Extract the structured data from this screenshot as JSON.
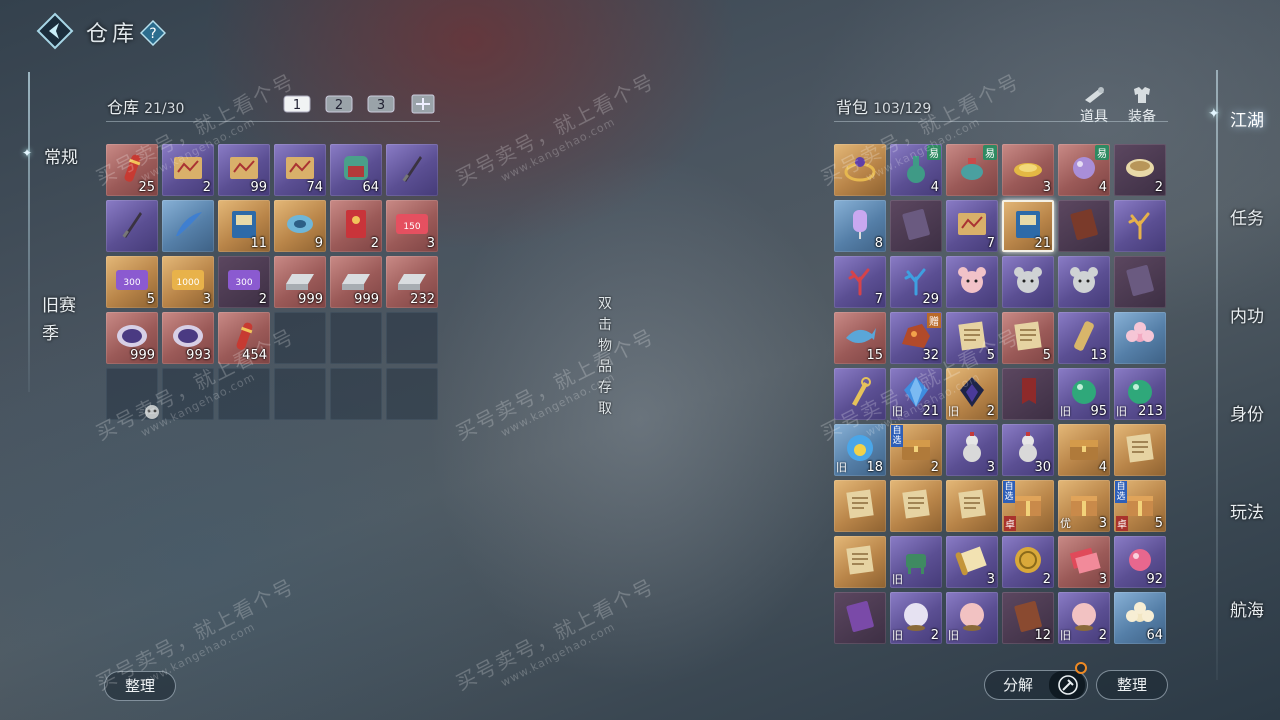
{
  "header": {
    "title": "仓库",
    "help": "?"
  },
  "left_tabs": [
    {
      "label": "常规",
      "active": true
    },
    {
      "label": "旧赛季",
      "active": false
    }
  ],
  "warehouse": {
    "label": "仓库",
    "count": "21/30",
    "pages": [
      "1",
      "2",
      "3"
    ],
    "sort_label": "整理",
    "slots": [
      {
        "q": "red",
        "icon": "red-scroll",
        "qty": "25"
      },
      {
        "q": "purple",
        "icon": "treasure-map",
        "qty": "2"
      },
      {
        "q": "purple",
        "icon": "treasure-map",
        "qty": "99"
      },
      {
        "q": "purple",
        "icon": "treasure-map",
        "qty": "74"
      },
      {
        "q": "purple",
        "icon": "jade-seal",
        "qty": "64"
      },
      {
        "q": "purple",
        "icon": "dagger",
        "qty": ""
      },
      {
        "q": "purple",
        "icon": "dagger",
        "qty": ""
      },
      {
        "q": "blue",
        "icon": "blue-feather",
        "qty": ""
      },
      {
        "q": "gold",
        "icon": "blue-book",
        "qty": "11"
      },
      {
        "q": "gold",
        "icon": "blue-disc",
        "qty": "9"
      },
      {
        "q": "red",
        "icon": "red-envelope",
        "qty": "2"
      },
      {
        "q": "red",
        "icon": "voucher-150",
        "qty": "3",
        "label": "150"
      },
      {
        "q": "gold",
        "icon": "voucher-300",
        "qty": "5",
        "label": "300"
      },
      {
        "q": "gold",
        "icon": "voucher-1000",
        "qty": "3",
        "label": "1000"
      },
      {
        "q": "dark",
        "icon": "voucher-300",
        "qty": "2",
        "label": "300"
      },
      {
        "q": "red",
        "icon": "silver-ingot",
        "qty": "999"
      },
      {
        "q": "red",
        "icon": "silver-ingot",
        "qty": "999"
      },
      {
        "q": "red",
        "icon": "silver-ingot",
        "qty": "232"
      },
      {
        "q": "red",
        "icon": "purple-bowl",
        "qty": "999"
      },
      {
        "q": "red",
        "icon": "purple-bowl",
        "qty": "993"
      },
      {
        "q": "red",
        "icon": "red-firecracker",
        "qty": "454"
      }
    ],
    "total_slots": 30
  },
  "hint": "双击物品存取",
  "backpack": {
    "label": "背包",
    "count": "103/129",
    "categories": [
      {
        "label": "道具",
        "icon": "scroll-icon"
      },
      {
        "label": "装备",
        "icon": "armor-icon"
      }
    ],
    "decompose_label": "分解",
    "sort_label": "整理",
    "slots": [
      {
        "q": "gold",
        "icon": "jewel-ring",
        "qty": ""
      },
      {
        "q": "purple",
        "icon": "green-flask",
        "qty": "4",
        "tag": "易"
      },
      {
        "q": "red",
        "icon": "teapot",
        "qty": "",
        "tag": "易"
      },
      {
        "q": "red",
        "icon": "gold-plate",
        "qty": "3"
      },
      {
        "q": "red",
        "icon": "purple-pearl",
        "qty": "4",
        "tag": "易"
      },
      {
        "q": "dark",
        "icon": "bowl",
        "qty": "2"
      },
      {
        "q": "blue",
        "icon": "lantern",
        "qty": "8"
      },
      {
        "q": "dark",
        "icon": "card",
        "qty": ""
      },
      {
        "q": "purple",
        "icon": "treasure-map",
        "qty": "7"
      },
      {
        "q": "gold",
        "icon": "blue-book",
        "qty": "21",
        "selected": true
      },
      {
        "q": "dark",
        "icon": "discount-card",
        "qty": ""
      },
      {
        "q": "purple",
        "icon": "coral",
        "qty": ""
      },
      {
        "q": "purple",
        "icon": "red-coral",
        "qty": "7"
      },
      {
        "q": "purple",
        "icon": "blue-coral",
        "qty": "29"
      },
      {
        "q": "purple",
        "icon": "pink-mouse",
        "qty": ""
      },
      {
        "q": "purple",
        "icon": "gray-mouse",
        "qty": ""
      },
      {
        "q": "purple",
        "icon": "gray-mouse",
        "qty": ""
      },
      {
        "q": "dark",
        "icon": "faded-card",
        "qty": ""
      },
      {
        "q": "red",
        "icon": "blue-fish",
        "qty": "15"
      },
      {
        "q": "purple",
        "icon": "ore",
        "qty": "32",
        "tag": "赠"
      },
      {
        "q": "purple",
        "icon": "paper",
        "qty": "5"
      },
      {
        "q": "red",
        "icon": "paper",
        "qty": "5"
      },
      {
        "q": "purple",
        "icon": "bamboo-tube",
        "qty": "13"
      },
      {
        "q": "blue",
        "icon": "pink-flower",
        "qty": ""
      },
      {
        "q": "purple",
        "icon": "gold-tool",
        "qty": ""
      },
      {
        "q": "purple",
        "icon": "blue-crystal",
        "qty": "21",
        "jiu": "旧"
      },
      {
        "q": "gold",
        "icon": "dark-crystal",
        "qty": "2",
        "jiu": "旧"
      },
      {
        "q": "dark",
        "icon": "red-banner",
        "qty": ""
      },
      {
        "q": "purple",
        "icon": "jade-ball",
        "qty": "95",
        "jiu": "旧"
      },
      {
        "q": "purple",
        "icon": "jade-ball",
        "qty": "213",
        "jiu": "旧"
      },
      {
        "q": "blue",
        "icon": "potion-bubble",
        "qty": "18",
        "jiu": "旧"
      },
      {
        "q": "gold",
        "icon": "chest",
        "qty": "2",
        "zixuan": "自选"
      },
      {
        "q": "purple",
        "icon": "gourd",
        "qty": "3"
      },
      {
        "q": "purple",
        "icon": "gourd",
        "qty": "30"
      },
      {
        "q": "gold",
        "icon": "chest",
        "qty": "4"
      },
      {
        "q": "gold",
        "icon": "letter",
        "qty": ""
      },
      {
        "q": "gold",
        "icon": "letter",
        "qty": ""
      },
      {
        "q": "gold",
        "icon": "letter",
        "qty": ""
      },
      {
        "q": "gold",
        "icon": "letter",
        "qty": ""
      },
      {
        "q": "gold",
        "icon": "gift-box",
        "qty": "",
        "zixuan": "自选",
        "zhuo": "卓"
      },
      {
        "q": "gold",
        "icon": "gift-box",
        "qty": "3",
        "you": "优"
      },
      {
        "q": "gold",
        "icon": "gift-box",
        "qty": "5",
        "zixuan": "自选",
        "zhuo": "卓"
      },
      {
        "q": "gold",
        "icon": "letter",
        "qty": ""
      },
      {
        "q": "purple",
        "icon": "bronze-vessel",
        "qty": "",
        "jiu": "旧"
      },
      {
        "q": "purple",
        "icon": "scroll",
        "qty": "3"
      },
      {
        "q": "purple",
        "icon": "gold-coin",
        "qty": "2"
      },
      {
        "q": "red",
        "icon": "red-tickets",
        "qty": "3"
      },
      {
        "q": "purple",
        "icon": "pink-orb",
        "qty": "92"
      },
      {
        "q": "dark",
        "icon": "gold-card",
        "qty": ""
      },
      {
        "q": "purple",
        "icon": "cloud-orb",
        "qty": "2",
        "jiu": "旧"
      },
      {
        "q": "purple",
        "icon": "crystal-ball",
        "qty": "",
        "jiu": "旧"
      },
      {
        "q": "dark",
        "icon": "brown-token",
        "qty": "12"
      },
      {
        "q": "purple",
        "icon": "crystal-ball",
        "qty": "2",
        "jiu": "旧"
      },
      {
        "q": "blue",
        "icon": "lotus",
        "qty": "64"
      }
    ]
  },
  "right_nav": [
    "江湖",
    "任务",
    "内功",
    "身份",
    "玩法",
    "航海"
  ],
  "watermark": {
    "line1": "买号卖号，就上看个号",
    "line2": "www.kangehao.com"
  },
  "colors": {
    "purple": "#6a5ca8",
    "red": "#a86260",
    "gold": "#c08c4e",
    "blue": "#5f88b2",
    "accent_orange": "#f08a24"
  }
}
